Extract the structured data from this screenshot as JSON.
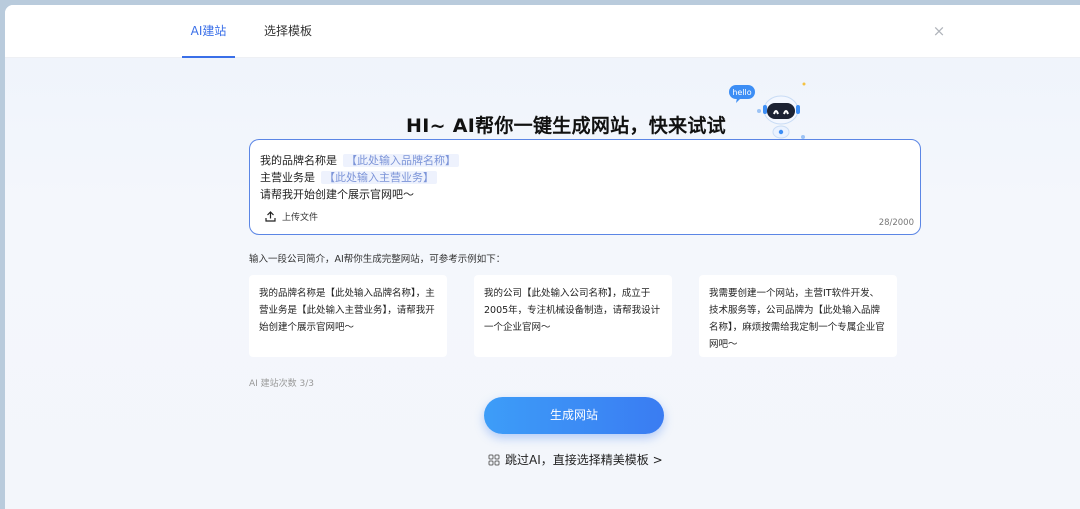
{
  "tabs": [
    {
      "label": "AI建站",
      "active": true
    },
    {
      "label": "选择模板",
      "active": false
    }
  ],
  "close_glyph": "×",
  "hero": {
    "title": "HI~ AI帮你一键生成网站，快来试试吧！",
    "badge": "hello"
  },
  "prompt": {
    "line1_prefix": "我的品牌名称是",
    "line1_placeholder": "【此处输入品牌名称】",
    "line2_prefix": "主营业务是",
    "line2_placeholder": "【此处输入主营业务】",
    "line3": "请帮我开始创建个展示官网吧～",
    "upload_label": "上传文件",
    "counter": "28/2000"
  },
  "hint": "输入一段公司简介，AI帮你生成完整网站，可参考示例如下：",
  "examples": [
    "我的品牌名称是【此处输入品牌名称】，主营业务是【此处输入主营业务】，请帮我开始创建个展示官网吧～",
    "我的公司【此处输入公司名称】，成立于2005年，专注机械设备制造，请帮我设计一个企业官网～",
    "我需要创建一个网站，主营IT软件开发、技术服务等，公司品牌为【此处输入品牌名称】，麻烦按需给我定制一个专属企业官网吧～"
  ],
  "quota": "AI 建站次数 3/3",
  "generate_label": "生成网站",
  "skip_label": "跳过AI，直接选择精美模板 >",
  "colors": {
    "accent": "#3a6fe8",
    "button": "#3a8cf5"
  }
}
